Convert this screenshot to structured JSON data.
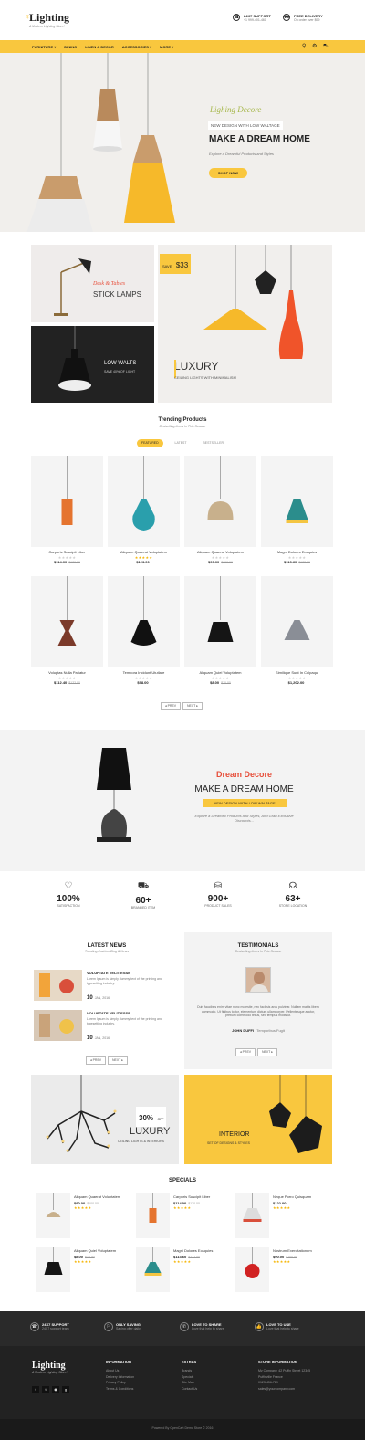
{
  "header": {
    "logo": "Lighting",
    "tagline": "A Modern Lighting Store!",
    "support_title": "24X7 SUPPORT",
    "support_sub": "+1 999-401-461",
    "delivery_title": "FREE DELIVERY",
    "delivery_sub": "On order over $99"
  },
  "nav": {
    "items": [
      "FURNITURE ▾",
      "DINING",
      "LINEN & DECOR",
      "ACCESSORIES ▾",
      "MORE ▾"
    ]
  },
  "hero": {
    "script": "Lighing Decore",
    "badge": "NEW DESIGN WITH LOW WALTAGE",
    "title": "MAKE A DREAM HOME",
    "sub": "Explore a Dreamful Products and Styles",
    "button": "SHOP NOW"
  },
  "banners": {
    "desk_script": "Desk & Tables",
    "desk_title": "STICK LAMPS",
    "low_title": "LOW WALTS",
    "low_sub": "SAVE 40% OF LIGHT",
    "save_label": "SAVE",
    "save_amount": "$33",
    "luxury_title": "LUXURY",
    "luxury_sub": "CEILING LIGHTS WITH MINIMALISM"
  },
  "trending": {
    "title": "Trending Products",
    "sub": "Bestselling Items In This Season",
    "tabs": [
      "FEATURED",
      "LATEST",
      "BESTSELLER"
    ],
    "products": [
      {
        "name": "Carporis Suscipit Liber",
        "price": "$114.00",
        "old": "$120.00",
        "stars": "★★★★★",
        "rated": false
      },
      {
        "name": "Aliquam Quaerat Voluptatem",
        "price": "$123.00",
        "old": "",
        "stars": "★★★★★",
        "rated": true
      },
      {
        "name": "Aliquam Quaerat Voluptatem",
        "price": "$90.00",
        "old": "$100.00",
        "stars": "★★★★★",
        "rated": false
      },
      {
        "name": "Magni Dolores Eosquies",
        "price": "$113.60",
        "old": "$122.00",
        "stars": "★★★★★",
        "rated": false
      },
      {
        "name": "Voluptas Nulla Pariatur",
        "price": "$112.40",
        "old": "$122.00",
        "stars": "★★★★★",
        "rated": false
      },
      {
        "name": "Tempora Incidunt Ututlare",
        "price": "$98.00",
        "old": "",
        "stars": "★★★★★",
        "rated": false
      },
      {
        "name": "Aliquam Quiel Voluptatem",
        "price": "$8.00",
        "old": "$10.00",
        "stars": "★★★★★",
        "rated": false
      },
      {
        "name": "Similique Sunt In Culpaqui",
        "price": "$1,202.00",
        "old": "",
        "stars": "★★★★★",
        "rated": false
      }
    ],
    "prev": "◂ PREV",
    "next": "NEXT ▸"
  },
  "dream": {
    "script": "Dream Decore",
    "title": "MAKE A DREAM HOME",
    "badge": "NEW DESIGN WITH LOW WALTAGE",
    "sub": "Explore a Dreamful Products and Styles, And Grab Exclusive Discounts..."
  },
  "stats": [
    {
      "value": "100%",
      "label": "SATISFACTION"
    },
    {
      "value": "60+",
      "label": "BRANDED ITEM"
    },
    {
      "value": "900+",
      "label": "PRODUCT SALES"
    },
    {
      "value": "63+",
      "label": "STORE LOCATION"
    }
  ],
  "news": {
    "title": "LATEST NEWS",
    "sub": "Trending Fashion Blog & News",
    "items": [
      {
        "title": "VOLUPTATE VELIT ESSE",
        "text": "Lorem Ipsum is simply dummy text of the printing and typesetting industry.",
        "date": "10",
        "month": "JAN, 2016"
      },
      {
        "title": "VOLUPTATE VELIT ESSE",
        "text": "Lorem Ipsum is simply dummy text of the printing and typesetting industry.",
        "date": "10",
        "month": "JAN, 2016"
      }
    ],
    "prev": "◂ PREV",
    "next": "NEXT ▸"
  },
  "testimonials": {
    "title": "TESTIMONIALS",
    "sub": "Bestselling Items In This Season",
    "quote": "Duis faucibus enim vitae nunc molestie, nec facilisis arcu pulvinar. Nullam mattis libero commodo. Ut finibus tortor, elementum dictum ullamcorper. Pellentesque auctor, pretium commodo tellus, sed tempus mollis ut.",
    "name": "JOHN DUFFI",
    "role": "Temporibus Fugit",
    "prev": "◂ PREV",
    "next": "NEXT ▸"
  },
  "promo": {
    "percent": "30%",
    "off": "OFF",
    "luxury": "LUXURY",
    "luxury_sub": "CEILING LIGHTS & INTERIORS",
    "interior": "INTERIOR",
    "interior_sub": "SET OF DESIGNS & STYLES"
  },
  "specials": {
    "title": "SPECIALS",
    "items": [
      {
        "name": "Aliquam Quaerat Voluptatem",
        "price": "$90.00",
        "old": "$100.00"
      },
      {
        "name": "Carporis Suscipit Liber",
        "price": "$114.00",
        "old": "$120.00"
      },
      {
        "name": "Neque Porro Quisquam",
        "price": "$122.00",
        "old": ""
      },
      {
        "name": "Aliquam Quiel Voluptatem",
        "price": "$8.00",
        "old": "$10.00"
      },
      {
        "name": "Magni Dolores Eosquies",
        "price": "$113.60",
        "old": "$122.00"
      },
      {
        "name": "Nostrum Exercitationem",
        "price": "$90.00",
        "old": "$100.00"
      }
    ]
  },
  "footer": {
    "features": [
      {
        "title": "24X7 SUPPORT",
        "sub": "24X7 support team"
      },
      {
        "title": "ONLY SAVING",
        "sub": "Saving offer daily"
      },
      {
        "title": "LOVE TO SHARE",
        "sub": "Love that help to share"
      },
      {
        "title": "LOVE TO USE",
        "sub": "Love that help to share"
      }
    ],
    "information_title": "INFORMATION",
    "information": [
      "About Us",
      "Delivery Information",
      "Privacy Policy",
      "Terms & Conditions"
    ],
    "extras_title": "EXTRAS",
    "extras": [
      "Brands",
      "Specials",
      "Site Map",
      "Contact Us"
    ],
    "store_title": "STORE INFORMATION",
    "store": [
      "My Company, 42 Puffin Street 12345",
      "Puffinville France",
      "0123-456-789",
      "sales@yourcompany.com"
    ],
    "copyright": "Powered By OpenCart Demo Store © 2016"
  },
  "colors": {
    "accent": "#f9c73e",
    "dark": "#1d1d1d"
  }
}
